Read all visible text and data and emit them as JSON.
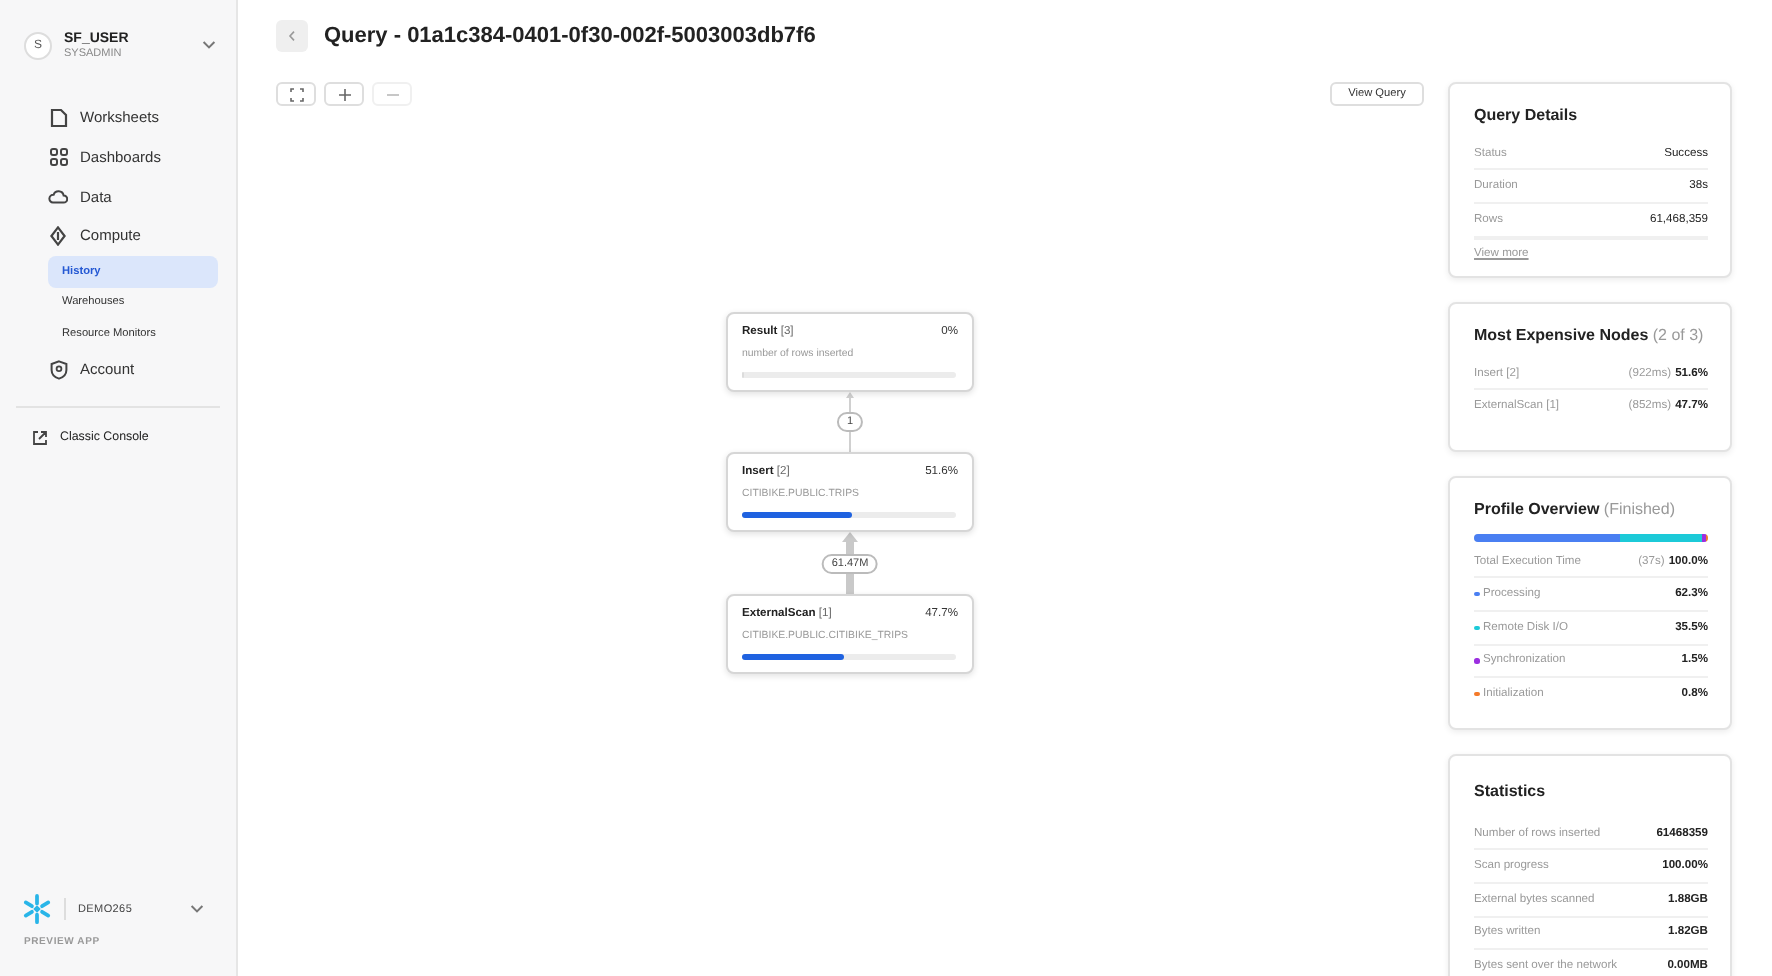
{
  "sidebar": {
    "user": {
      "avatar": "S",
      "name": "SF_USER",
      "role": "SYSADMIN"
    },
    "nav": [
      {
        "label": "Worksheets",
        "selected": false
      },
      {
        "label": "Dashboards",
        "selected": false
      },
      {
        "label": "Data",
        "selected": false
      },
      {
        "label": "Compute",
        "selected": false,
        "children": [
          {
            "label": "History",
            "selected": true
          },
          {
            "label": "Warehouses",
            "selected": false
          },
          {
            "label": "Resource Monitors",
            "selected": false
          }
        ]
      },
      {
        "label": "Account",
        "selected": false
      }
    ],
    "links": [
      {
        "label": "Classic Console"
      }
    ],
    "account": {
      "name": "DEMO265",
      "note": "PREVIEW APP"
    }
  },
  "header": {
    "title": "Query - 01a1c384-0401-0f30-002f-5003003db7f6"
  },
  "toolbar": {
    "buttons": [
      {
        "kind": "fit",
        "disabled": false
      },
      {
        "kind": "zoom-in",
        "disabled": false
      },
      {
        "kind": "zoom-out",
        "disabled": true
      }
    ],
    "view_query": "View Query"
  },
  "graph": {
    "nodes": [
      {
        "name": "Result",
        "id": "[3]",
        "percent": "0%",
        "detail": "number of rows inserted",
        "level": 0
      },
      {
        "name": "Insert",
        "id": "[2]",
        "percent": "51.6%",
        "detail": "CITIBIKE.PUBLIC.TRIPS",
        "level": 0.516
      },
      {
        "name": "ExternalScan",
        "id": "[1]",
        "percent": "47.7%",
        "detail": "CITIBIKE.PUBLIC.CITIBIKE_TRIPS",
        "level": 0.477
      }
    ],
    "edges": [
      {
        "label": "1",
        "kind": "thin"
      },
      {
        "label": "61.47M",
        "kind": "thick"
      }
    ]
  },
  "query_details": {
    "title": "Query Details",
    "rows": [
      {
        "label": "Status",
        "value": "Success"
      },
      {
        "label": "Duration",
        "value": "38s"
      },
      {
        "label": "Rows",
        "value": "61,468,359"
      }
    ],
    "link": "View more"
  },
  "expensive_nodes": {
    "title": "Most Expensive Nodes",
    "subtitle": "(2 of 3)",
    "rows": [
      {
        "label": "Insert [2]",
        "time": "(922ms)",
        "value": "51.6%"
      },
      {
        "label": "ExternalScan [1]",
        "time": "(852ms)",
        "value": "47.7%"
      }
    ]
  },
  "profile_overview": {
    "title": "Profile Overview",
    "subtitle": "(Finished)",
    "total": {
      "label": "Total Execution Time",
      "time": "(37s)",
      "value": "100.0%"
    },
    "rows": [
      {
        "label": "Processing",
        "value": "62.3%",
        "color": "#4a7ff2",
        "level": 0.623
      },
      {
        "label": "Remote Disk I/O",
        "value": "35.5%",
        "color": "#1ccad8",
        "level": 0.355
      },
      {
        "label": "Synchronization",
        "value": "1.5%",
        "color": "#9b2fe0",
        "level": 0.015
      },
      {
        "label": "Initialization",
        "value": "0.8%",
        "color": "#f47a2a",
        "level": 0.008
      }
    ]
  },
  "statistics": {
    "title": "Statistics",
    "rows": [
      {
        "label": "Number of rows inserted",
        "value": "61468359"
      },
      {
        "label": "Scan progress",
        "value": "100.00%"
      },
      {
        "label": "External bytes scanned",
        "value": "1.88GB"
      },
      {
        "label": "Bytes written",
        "value": "1.82GB"
      },
      {
        "label": "Bytes sent over the network",
        "value": "0.00MB"
      }
    ]
  }
}
